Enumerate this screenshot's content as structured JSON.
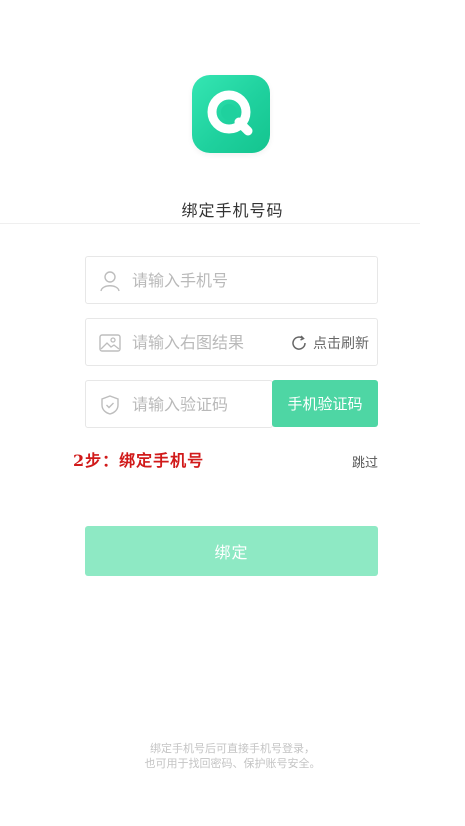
{
  "header": {
    "title": "绑定手机号码"
  },
  "form": {
    "phone": {
      "placeholder": "请输入手机号",
      "icon": "user-icon"
    },
    "captcha": {
      "placeholder": "请输入右图结果",
      "icon": "image-icon",
      "refresh_label": "点击刷新"
    },
    "code": {
      "placeholder": "请输入验证码",
      "icon": "shield-icon",
      "send_button": "手机验证码"
    }
  },
  "step_label": "2步：绑定手机号",
  "skip_label": "跳过",
  "bind_button": "绑定",
  "footer": {
    "line1": "绑定手机号后可直接手机号登录，",
    "line2": "也可用于找回密码、保护账号安全。"
  },
  "colors": {
    "brand": "#1fd19e",
    "button": "#4ed6a4",
    "button_disabled": "#8ee9c4",
    "step": "#d11a1a"
  }
}
